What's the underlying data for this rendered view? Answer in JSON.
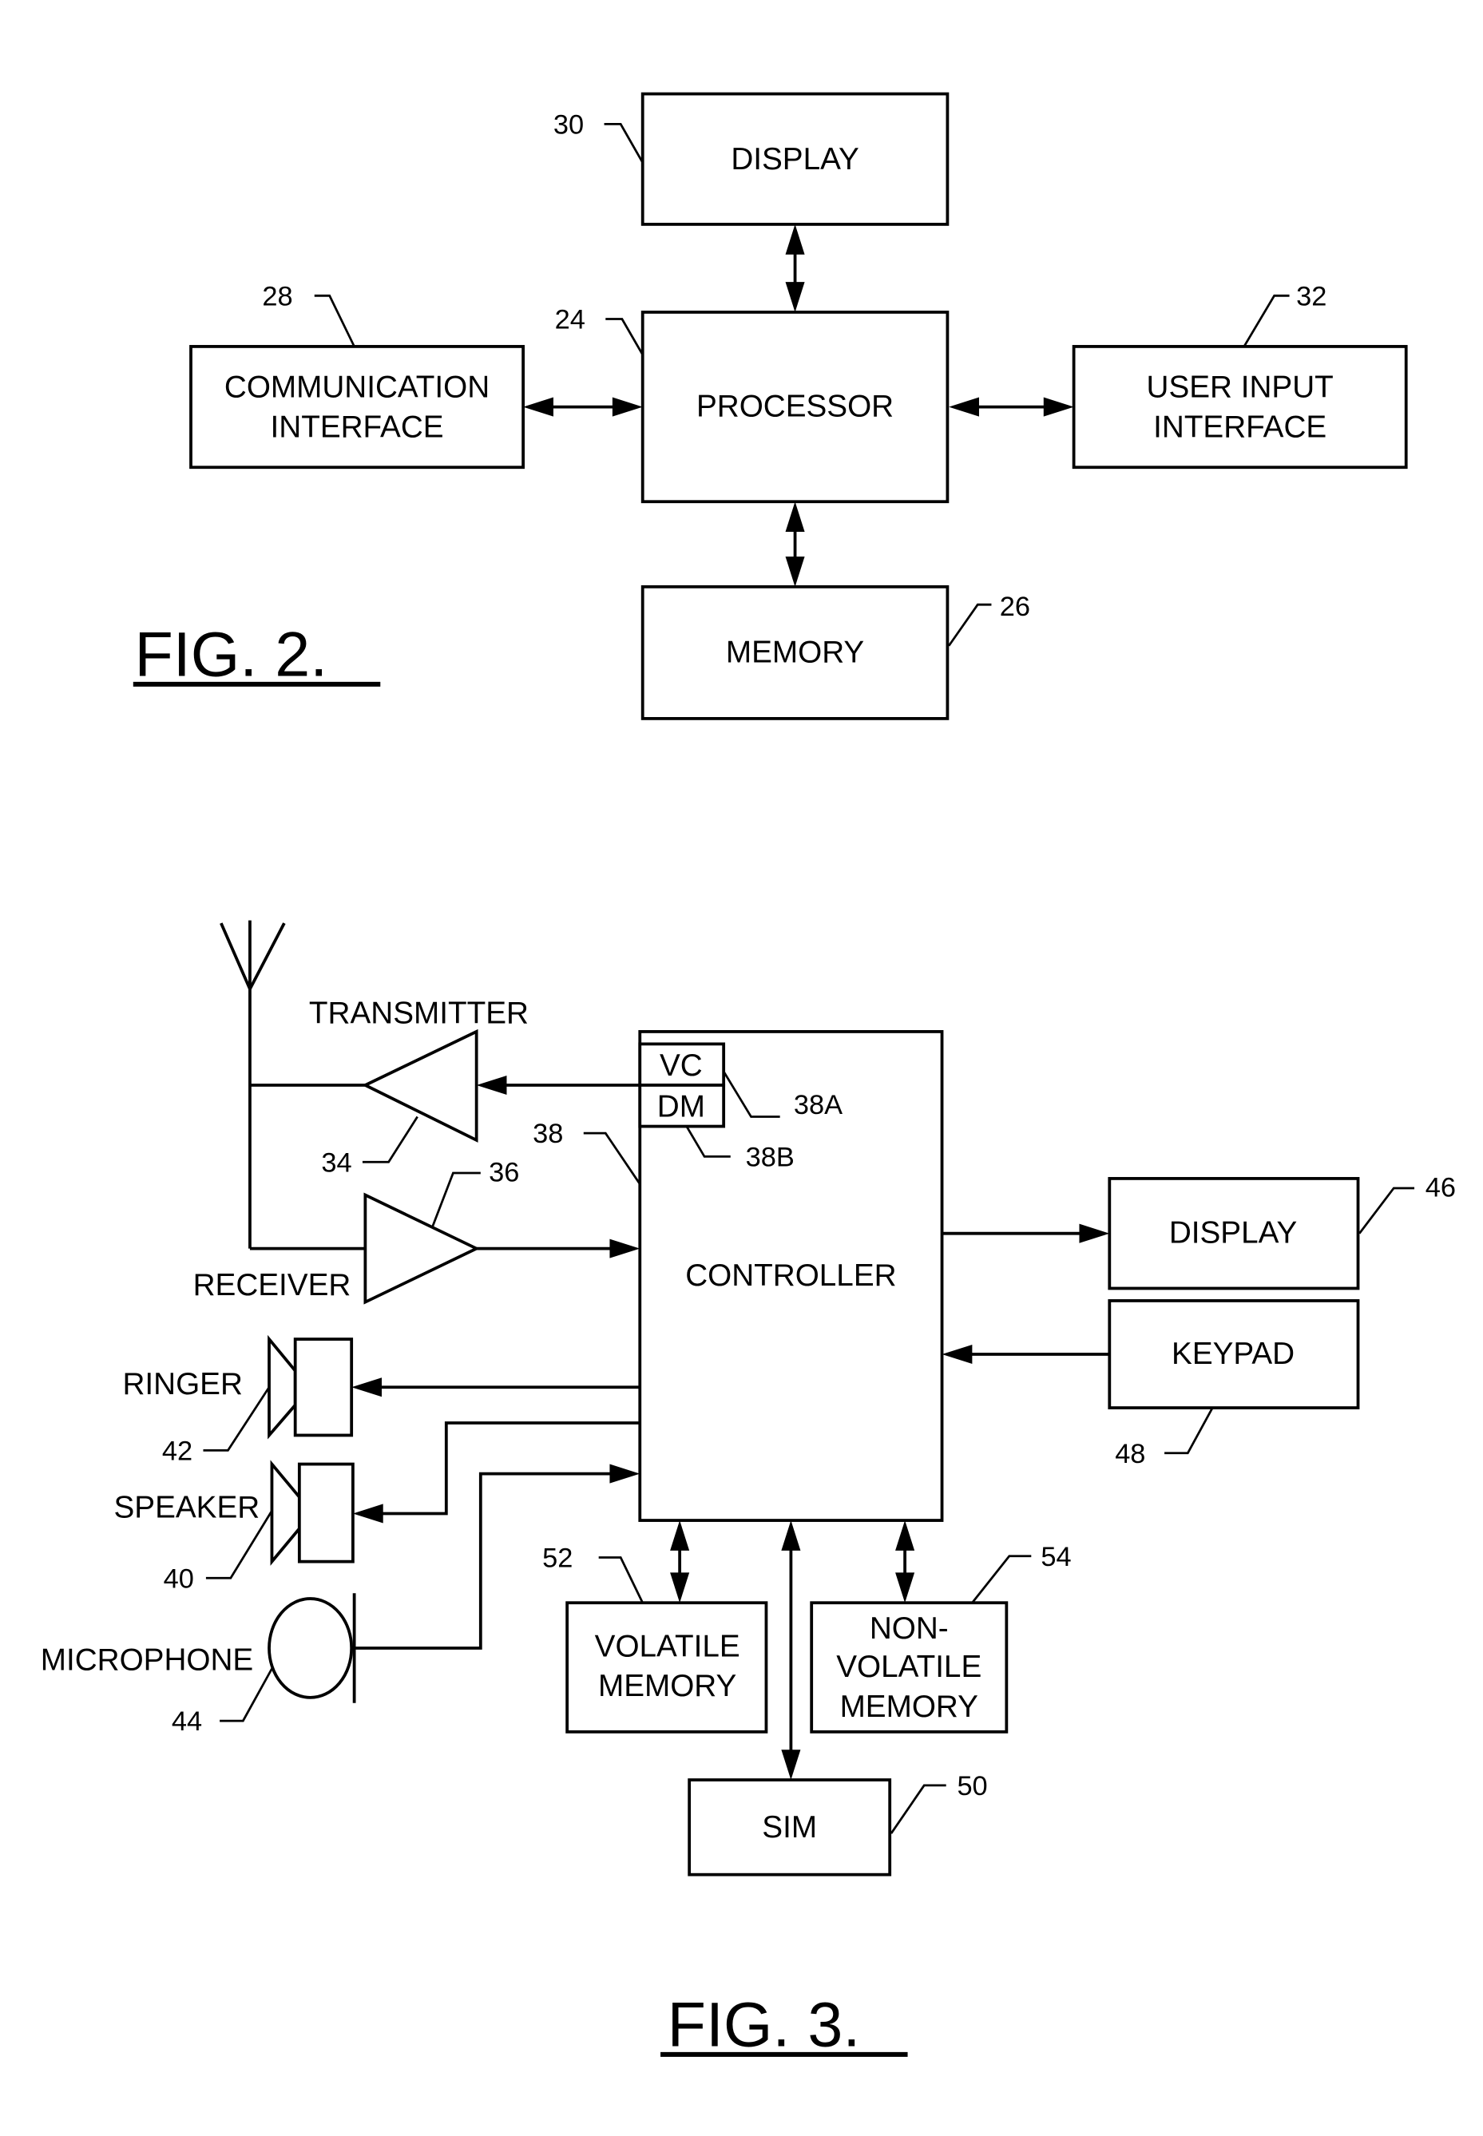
{
  "fig2": {
    "caption": "FIG. 2.",
    "blocks": {
      "display": {
        "lines": [
          "DISPLAY"
        ],
        "ref": "30"
      },
      "processor": {
        "lines": [
          "PROCESSOR"
        ],
        "ref": "24"
      },
      "memory": {
        "lines": [
          "MEMORY"
        ],
        "ref": "26"
      },
      "communication_interface": {
        "lines": [
          "COMMUNICATION",
          "INTERFACE"
        ],
        "ref": "28"
      },
      "user_input_interface": {
        "lines": [
          "USER INPUT",
          "INTERFACE"
        ],
        "ref": "32"
      }
    }
  },
  "fig3": {
    "caption": "FIG. 3.",
    "blocks": {
      "controller": {
        "lines": [
          "CONTROLLER"
        ],
        "ref": "38"
      },
      "vc": {
        "lines": [
          "VC"
        ],
        "ref": "38A"
      },
      "dm": {
        "lines": [
          "DM"
        ],
        "ref": "38B"
      },
      "display": {
        "lines": [
          "DISPLAY"
        ],
        "ref": "46"
      },
      "keypad": {
        "lines": [
          "KEYPAD"
        ],
        "ref": "48"
      },
      "volatile_memory": {
        "lines": [
          "VOLATILE",
          "MEMORY"
        ],
        "ref": "52"
      },
      "non_volatile_memory": {
        "lines": [
          "NON-",
          "VOLATILE",
          "MEMORY"
        ],
        "ref": "54"
      },
      "sim": {
        "lines": [
          "SIM"
        ],
        "ref": "50"
      }
    },
    "components": {
      "transmitter": {
        "label": "TRANSMITTER",
        "ref": "34"
      },
      "receiver": {
        "label": "RECEIVER",
        "ref": "36"
      },
      "ringer": {
        "label": "RINGER",
        "ref": "42"
      },
      "speaker": {
        "label": "SPEAKER",
        "ref": "40"
      },
      "microphone": {
        "label": "MICROPHONE",
        "ref": "44"
      }
    }
  }
}
